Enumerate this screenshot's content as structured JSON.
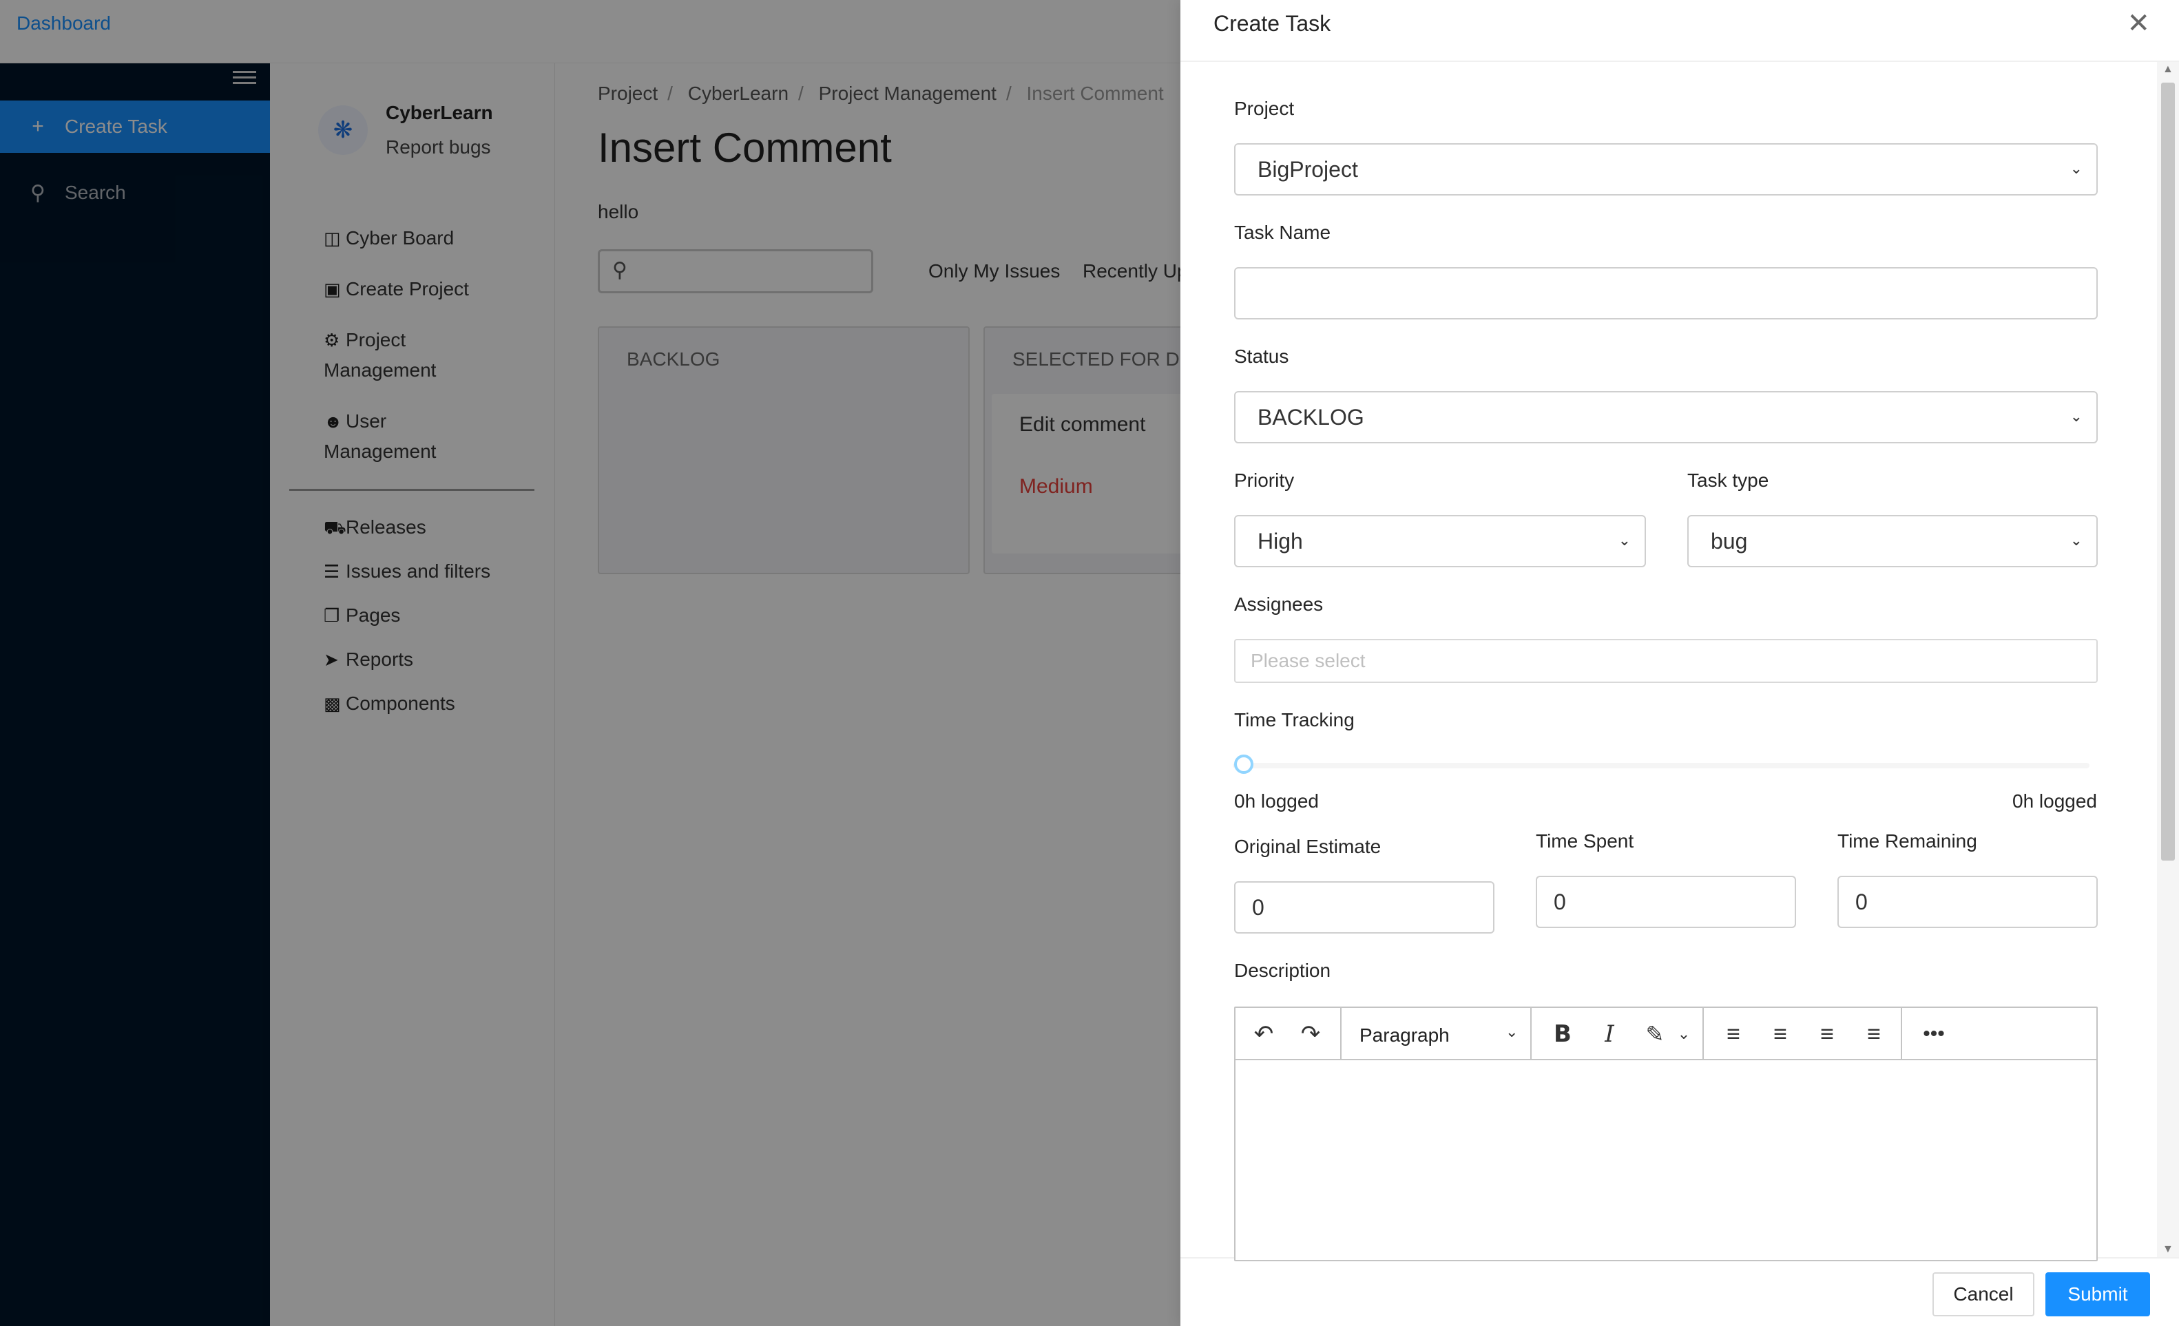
{
  "topbar": {
    "dashboard_link": "Dashboard"
  },
  "sidebar": {
    "items": [
      {
        "label": "Create Task",
        "icon": "plus-icon",
        "active": true
      },
      {
        "label": "Search",
        "icon": "search-icon",
        "active": false
      }
    ]
  },
  "submenu": {
    "brand_name": "CyberLearn",
    "brand_sub": "Report bugs",
    "items": [
      {
        "label": "Cyber Board",
        "icon": "board-icon"
      },
      {
        "label": "Create Project",
        "icon": "folder-plus-icon"
      },
      {
        "label": "Project",
        "label2": "Management",
        "icon": "gear-icon"
      },
      {
        "label": "User",
        "label2": "Management",
        "icon": "users-icon"
      },
      {
        "label": "Releases",
        "icon": "truck-icon"
      },
      {
        "label": "Issues and filters",
        "icon": "bars-icon"
      },
      {
        "label": "Pages",
        "icon": "copy-icon"
      },
      {
        "label": "Reports",
        "icon": "paper-plane-icon"
      },
      {
        "label": "Components",
        "icon": "box-icon"
      }
    ]
  },
  "main": {
    "breadcrumb": [
      "Project",
      "CyberLearn",
      "Project Management",
      "Insert Comment"
    ],
    "title": "Insert Comment",
    "description": "hello",
    "filters": [
      "Only My Issues",
      "Recently Up"
    ],
    "columns": [
      {
        "title": "BACKLOG"
      },
      {
        "title": "SELECTED FOR DEV",
        "card": {
          "title": "Edit comment",
          "priority": "Medium"
        }
      }
    ]
  },
  "drawer": {
    "title": "Create Task",
    "fields": {
      "project_label": "Project",
      "project_value": "BigProject",
      "task_name_label": "Task Name",
      "task_name_value": "",
      "status_label": "Status",
      "status_value": "BACKLOG",
      "priority_label": "Priority",
      "priority_value": "High",
      "task_type_label": "Task type",
      "task_type_value": "bug",
      "assignees_label": "Assignees",
      "assignees_placeholder": "Please select",
      "time_tracking_label": "Time Tracking",
      "time_tracking_value": 0,
      "logged_left": "0h logged",
      "logged_right": "0h logged",
      "original_estimate_label": "Original Estimate",
      "original_estimate_value": "0",
      "time_spent_label": "Time Spent",
      "time_spent_value": "0",
      "time_remaining_label": "Time Remaining",
      "time_remaining_value": "0",
      "description_label": "Description"
    },
    "editor": {
      "block_format": "Paragraph"
    },
    "footer": {
      "cancel": "Cancel",
      "submit": "Submit"
    }
  },
  "colors": {
    "accent": "#1890ff",
    "sidebar_bg": "#001529",
    "priority_medium": "#e8413b"
  }
}
